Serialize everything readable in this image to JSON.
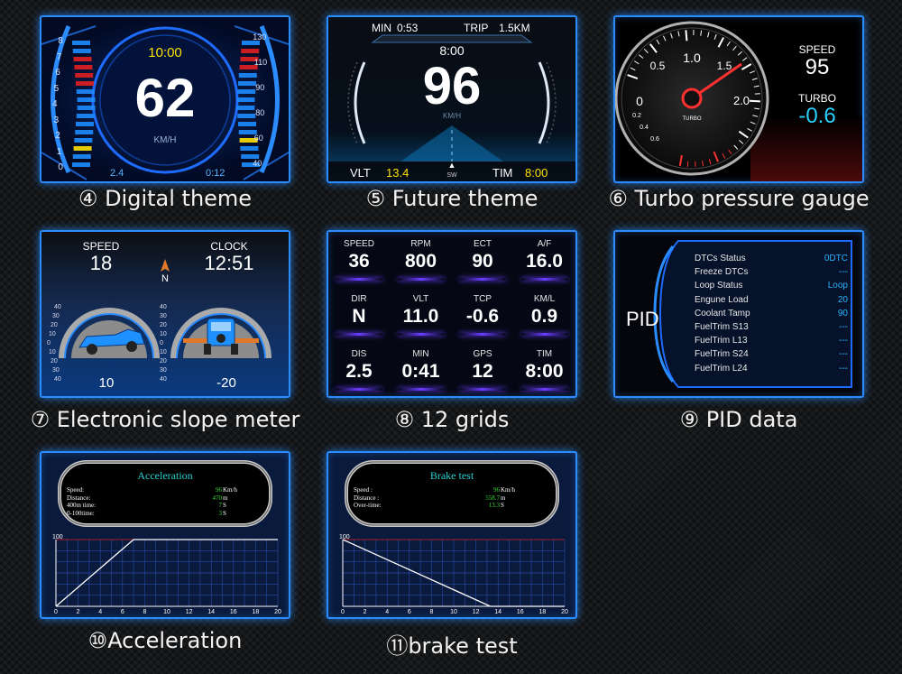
{
  "colors": {
    "accent": "#2a8cff",
    "yellow": "#ffe100",
    "cyan": "#2ad0ff",
    "red": "#e02020"
  },
  "digital": {
    "caption": "④ Digital theme",
    "time": "10:00",
    "speed": "62",
    "unit": "KM/H",
    "left_bottom": "2.4",
    "right_bottom": "0:12",
    "left_ticks": [
      "8",
      "7",
      "6",
      "5",
      "4",
      "3",
      "2",
      "1",
      "0"
    ],
    "right_ticks": [
      "130",
      "110",
      "90",
      "80",
      "60",
      "40"
    ]
  },
  "future": {
    "caption": "⑤ Future theme",
    "min_label": "MIN",
    "min_value": "0:53",
    "trip_label": "TRIP",
    "trip_value": "1.5KM",
    "time": "8:00",
    "speed": "96",
    "unit": "KM/H",
    "vlt_label": "VLT",
    "vlt_value": "13.4",
    "compass": "SW",
    "tim_label": "TIM",
    "tim_value": "8:00"
  },
  "turbo": {
    "caption": "⑥ Turbo pressure gauge",
    "ticks": [
      "0.5",
      "1.0",
      "1.5",
      "2.0",
      "0"
    ],
    "sub_ticks": [
      "0.2",
      "0.4",
      "0.6"
    ],
    "gauge_label": "TURBO",
    "speed_label": "SPEED",
    "speed_value": "95",
    "turbo_label": "TURBO",
    "turbo_value": "-0.6"
  },
  "slope": {
    "caption": "⑦ Electronic slope meter",
    "speed_label": "SPEED",
    "speed_value": "18",
    "clock_label": "CLOCK",
    "clock_value": "12:51",
    "compass": "N",
    "left_value": "10",
    "right_value": "-20",
    "scale": [
      "40",
      "30",
      "20",
      "10",
      "0",
      "10",
      "20",
      "30",
      "40"
    ]
  },
  "grids": {
    "caption": "⑧ 12 grids",
    "cells": [
      {
        "label": "SPEED",
        "value": "36"
      },
      {
        "label": "RPM",
        "value": "800"
      },
      {
        "label": "ECT",
        "value": "90"
      },
      {
        "label": "A/F",
        "value": "16.0"
      },
      {
        "label": "DIR",
        "value": "N"
      },
      {
        "label": "VLT",
        "value": "11.0"
      },
      {
        "label": "TCP",
        "value": "-0.6"
      },
      {
        "label": "KM/L",
        "value": "0.9"
      },
      {
        "label": "DIS",
        "value": "2.5"
      },
      {
        "label": "MIN",
        "value": "0:41"
      },
      {
        "label": "GPS",
        "value": "12"
      },
      {
        "label": "TIM",
        "value": "8:00"
      }
    ]
  },
  "pid": {
    "caption": "⑨ PID data",
    "title": "PID",
    "rows": [
      {
        "name": "DTCs Status",
        "value": "0DTC"
      },
      {
        "name": "Freeze DTCs",
        "value": "---"
      },
      {
        "name": "Loop Status",
        "value": "Loop"
      },
      {
        "name": "Engune Load",
        "value": "20"
      },
      {
        "name": "Coolant Tamp",
        "value": "90"
      },
      {
        "name": "FuelTrim S13",
        "value": "---"
      },
      {
        "name": "FuelTrim L13",
        "value": "---"
      },
      {
        "name": "FuelTrim S24",
        "value": "---"
      },
      {
        "name": "FuelTrim L24",
        "value": "---"
      }
    ]
  },
  "acceleration": {
    "caption": "⑩Acceleration",
    "title": "Acceleration",
    "rows": [
      {
        "name": "Speed:",
        "value": "96",
        "unit": "Km/h"
      },
      {
        "name": "Distance:",
        "value": "470",
        "unit": "m"
      },
      {
        "name": "400m time:",
        "value": "7",
        "unit": "S"
      },
      {
        "name": "0-100time:",
        "value": "3",
        "unit": "S"
      }
    ],
    "y_label": "100",
    "x_ticks": [
      "0",
      "2",
      "4",
      "6",
      "8",
      "10",
      "12",
      "14",
      "16",
      "18",
      "20"
    ],
    "curve": [
      [
        0,
        0
      ],
      [
        7,
        100
      ],
      [
        20,
        100
      ]
    ]
  },
  "brake": {
    "caption": "⑪brake test",
    "title": "Brake test",
    "rows": [
      {
        "name": "Speed        :",
        "value": "96",
        "unit": "Km/h"
      },
      {
        "name": "Distance   :",
        "value": "558.7",
        "unit": "m"
      },
      {
        "name": "Over-time:",
        "value": "13.3",
        "unit": "S"
      }
    ],
    "y_label": "100",
    "x_ticks": [
      "0",
      "2",
      "4",
      "6",
      "8",
      "10",
      "12",
      "14",
      "16",
      "18",
      "20"
    ],
    "curve": [
      [
        0,
        100
      ],
      [
        13.3,
        0
      ],
      [
        20,
        0
      ]
    ]
  }
}
